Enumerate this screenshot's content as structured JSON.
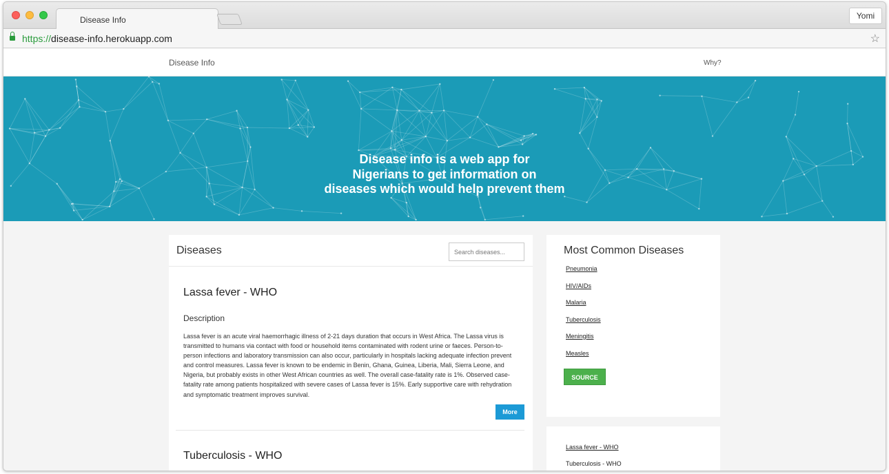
{
  "browser": {
    "tab_title": "Disease Info",
    "profile_name": "Yomi",
    "url_scheme": "https://",
    "url_host": "disease-info.herokuapp.com"
  },
  "navbar": {
    "brand": "Disease Info",
    "why_link": "Why?"
  },
  "hero": {
    "lines": [
      "Disease info is a web app for",
      "Nigerians to get information on",
      "diseases which would help prevent them"
    ],
    "background_color": "#1b9bb7"
  },
  "diseases_panel": {
    "title": "Diseases",
    "search_placeholder": "Search diseases...",
    "items": [
      {
        "title": "Lassa fever - WHO",
        "subtitle": "Description",
        "description": "Lassa fever is an acute viral haemorrhagic illness of 2-21 days duration that occurs in West Africa. The Lassa virus is transmitted to humans via contact with food or household items contaminated with rodent urine or faeces. Person-to-person infections and laboratory transmission can also occur, particularly in hospitals lacking adequate infection prevent and control measures. Lassa fever is known to be endemic in Benin, Ghana, Guinea, Liberia, Mali, Sierra Leone, and Nigeria, but probably exists in other West African countries as well. The overall case-fatality rate is 1%. Observed case-fatality rate among patients hospitalized with severe cases of Lassa fever is 15%. Early supportive care with rehydration and symptomatic treatment improves survival.",
        "more_label": "More"
      },
      {
        "title": "Tuberculosis - WHO"
      }
    ]
  },
  "common_panel": {
    "title": "Most Common Diseases",
    "links": [
      "Pneumonia",
      "HIV/AIDs",
      "Malaria",
      "Tuberculosis",
      "Meningitis",
      "Measles"
    ],
    "source_label": "SOURCE",
    "source_color": "#4cb04c"
  },
  "list_panel": {
    "links": [
      "Lassa fever - WHO",
      "Tuberculosis - WHO"
    ]
  },
  "colors": {
    "more_button": "#1c9ad6"
  }
}
